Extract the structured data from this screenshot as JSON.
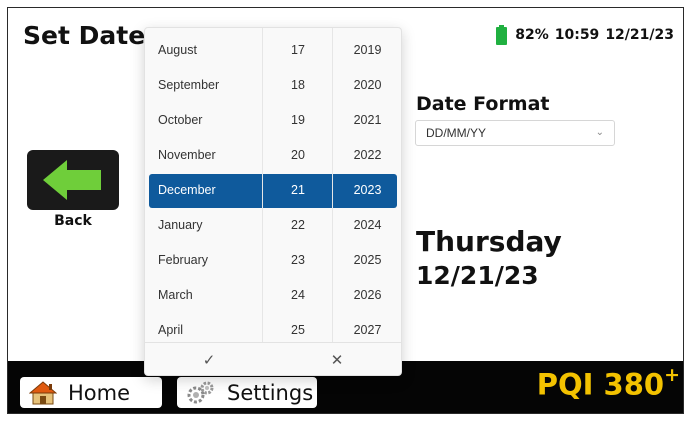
{
  "header": {
    "title": "Set Date",
    "battery_percent": "82%",
    "time": "10:59",
    "date": "12/21/23",
    "battery_color": "#20b040"
  },
  "back": {
    "label": "Back",
    "icon": "left-arrow-icon",
    "arrow_color": "#6fce3a"
  },
  "date_format": {
    "label": "Date Format",
    "selected": "DD/MM/YY",
    "chevron": "⌄"
  },
  "display": {
    "day_name": "Thursday",
    "date": "12/21/23"
  },
  "picker": {
    "months": [
      "August",
      "September",
      "October",
      "November",
      "December",
      "January",
      "February",
      "March",
      "April"
    ],
    "days": [
      "17",
      "18",
      "19",
      "20",
      "21",
      "22",
      "23",
      "24",
      "25"
    ],
    "years": [
      "2019",
      "2020",
      "2021",
      "2022",
      "2023",
      "2024",
      "2025",
      "2026",
      "2027"
    ],
    "selected_index": 4,
    "accept_glyph": "✓",
    "dismiss_glyph": "✕",
    "selection_color": "#0f5a9c"
  },
  "footer": {
    "home_label": "Home",
    "settings_label": "Settings",
    "brand": "PQI 380",
    "brand_sup": "+",
    "brand_color": "#f3c200"
  }
}
